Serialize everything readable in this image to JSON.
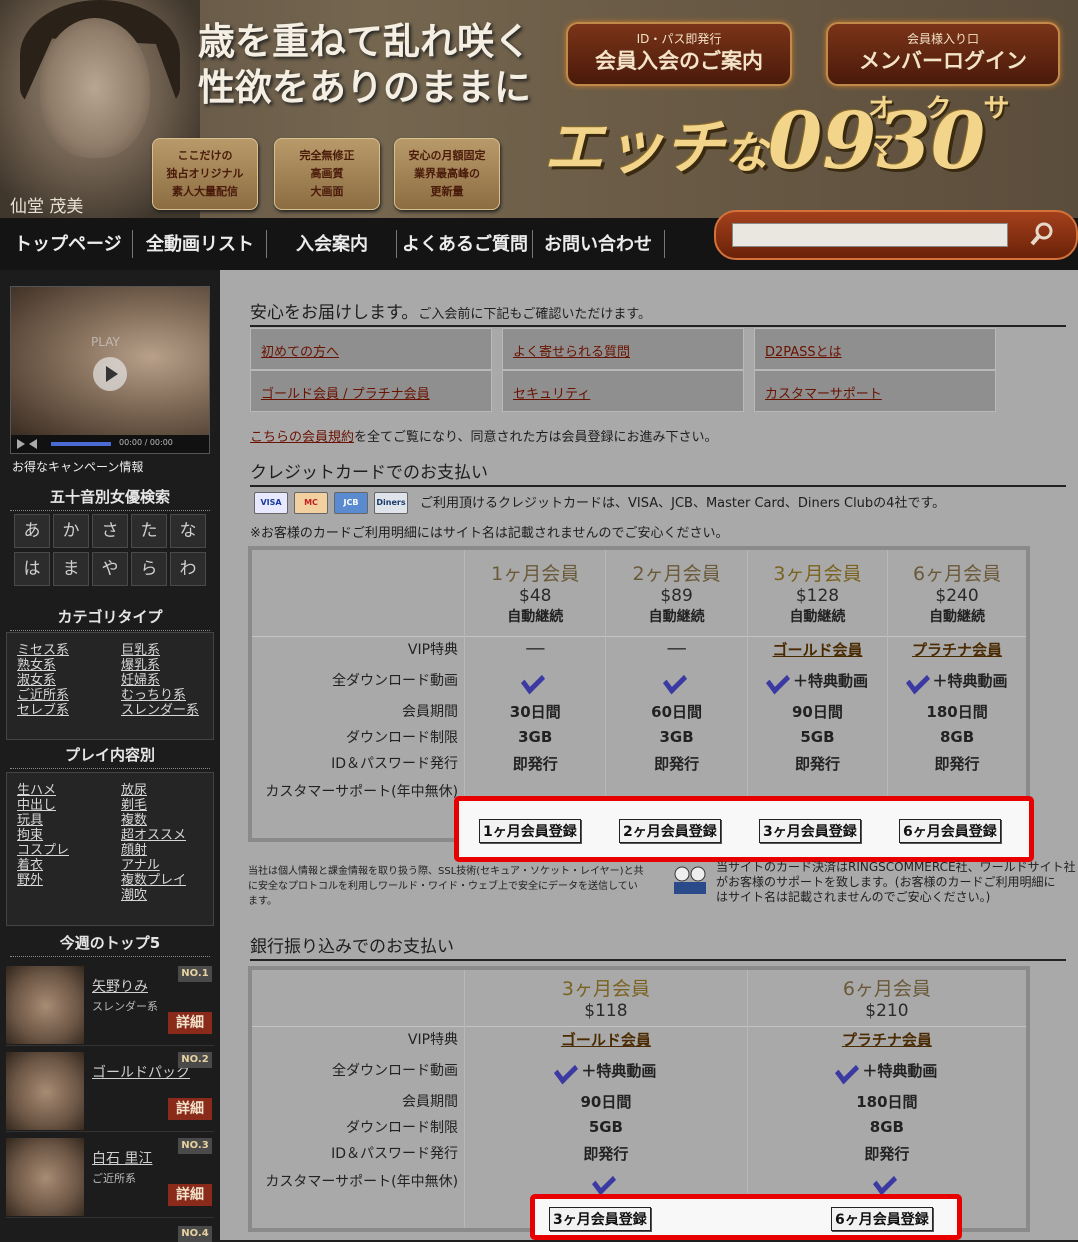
{
  "header": {
    "actress": "仙堂 茂美",
    "headline1": "歳を重ねて乱れ咲く",
    "headline2": "性欲をありのままに",
    "badges": [
      {
        "l1": "ここだけの",
        "l2": "独占オリジナル",
        "l3": "素人大量配信"
      },
      {
        "l1": "完全無修正",
        "l2": "高画質",
        "l3": "大画面"
      },
      {
        "l1": "安心の月額固定",
        "l2": "業界最高峰の",
        "l3": "更新量"
      }
    ],
    "join_small": "ID・パス即発行",
    "join_big": "会員入会のご案内",
    "login_small": "会員様入り口",
    "login_big": "メンバーログイン",
    "logo_main": "エッチ",
    "logo_na": "な",
    "logo_num": "0930",
    "logo_kana": "オクサマ"
  },
  "nav": [
    "トップページ",
    "全動画リスト",
    "入会案内",
    "よくあるご質問",
    "お問い合わせ"
  ],
  "sidebar": {
    "play": "PLAY",
    "time": "00:00 / 00:00",
    "promo_label": "お得なキャンペーン情報",
    "kana_title": "五十音別女優検索",
    "kana": [
      "あ",
      "か",
      "さ",
      "た",
      "な",
      "は",
      "ま",
      "や",
      "ら",
      "わ"
    ],
    "cat_title": "カテゴリタイプ",
    "cat_left": [
      "ミセス系",
      "熟女系",
      "淑女系",
      "ご近所系",
      "セレブ系"
    ],
    "cat_right": [
      "巨乳系",
      "爆乳系",
      "妊婦系",
      "むっちり系",
      "スレンダー系"
    ],
    "play_title": "プレイ内容別",
    "play_left": [
      "生ハメ",
      "中出し",
      "玩具",
      "拘束",
      "コスプレ",
      "着衣",
      "野外"
    ],
    "play_right": [
      "放尿",
      "剃毛",
      "複数",
      "超オススメ",
      "顔射",
      "アナル",
      "複数プレイ",
      "潮吹"
    ],
    "top_title": "今週のトップ5",
    "top5": [
      {
        "name": "矢野りみ",
        "cat": "スレンダー系",
        "no": "NO.1",
        "detail": "詳細"
      },
      {
        "name": "ゴールドパック",
        "cat": "",
        "no": "NO.2",
        "detail": "詳細"
      },
      {
        "name": "白石 里江",
        "cat": "ご近所系",
        "no": "NO.3",
        "detail": "詳細"
      }
    ],
    "no4": "NO.4"
  },
  "main": {
    "intro_title": "安心をお届けします。",
    "intro_sub": "ご入会前に下記もご確認いただけます。",
    "links": [
      "初めての方へ",
      "よく寄せられる質問",
      "D2PASSとは",
      "ゴールド会員 / プラチナ会員",
      "セキュリティ",
      "カスタマーサポート"
    ],
    "terms_link": "こちらの会員規約",
    "terms_rest": "を全てご覧になり、同意された方は会員登録にお進み下さい。",
    "cc_title": "クレジットカードでのお支払い",
    "cc_icons": [
      "VISA",
      "MC",
      "JCB",
      "Diners"
    ],
    "cc_note1": "ご利用頂けるクレジットカードは、VISA、JCB、Master Card、Diners Clubの4社です。",
    "cc_note2": "※お客様のカードご利用明細にはサイト名は記載されませんのでご安心ください。",
    "row_labels": [
      "VIP特典",
      "全ダウンロード動画",
      "会員期間",
      "ダウンロード制限",
      "ID＆パスワード発行",
      "カスタマーサポート(年中無休)"
    ],
    "cc_plans": [
      {
        "name": "1ヶ月会員",
        "price": "$48",
        "renew": "自動継続",
        "vip": "──",
        "bonus": "",
        "period": "30日間",
        "limit": "3GB",
        "issue": "即発行",
        "button": "1ヶ月会員登録"
      },
      {
        "name": "2ヶ月会員",
        "price": "$89",
        "renew": "自動継続",
        "vip": "──",
        "bonus": "",
        "period": "60日間",
        "limit": "3GB",
        "issue": "即発行",
        "button": "2ヶ月会員登録"
      },
      {
        "name": "3ヶ月会員",
        "price": "$128",
        "renew": "自動継続",
        "vip": "ゴールド会員",
        "bonus": "＋特典動画",
        "period": "90日間",
        "limit": "5GB",
        "issue": "即発行",
        "button": "3ヶ月会員登録"
      },
      {
        "name": "6ヶ月会員",
        "price": "$240",
        "renew": "自動継続",
        "vip": "プラチナ会員",
        "bonus": "＋特典動画",
        "period": "180日間",
        "limit": "8GB",
        "issue": "即発行",
        "button": "6ヶ月会員登録"
      }
    ],
    "ssl_note": "当社は個人情報と課金情報を取り扱う際、SSL技術(セキュア・ソケット・レイヤー)と共に安全なプロトコルを利用しワールド・ワイド・ウェブ上で安全にデータを送信しています。",
    "support_note1": "当サイトのカード決済はRINGSCOMMERCE社、ワールドサイト社",
    "support_note2": "がお客様のサポートを致します。(お客様のカードご利用明細に",
    "support_note3": "はサイト名は記載されませんのでご安心ください。)",
    "bank_title": "銀行振り込みでのお支払い",
    "bank_plans": [
      {
        "name": "3ヶ月会員",
        "price": "$118",
        "vip": "ゴールド会員",
        "bonus": "＋特典動画",
        "period": "90日間",
        "limit": "5GB",
        "issue": "即発行",
        "button": "3ヶ月会員登録"
      },
      {
        "name": "6ヶ月会員",
        "price": "$210",
        "vip": "プラチナ会員",
        "bonus": "＋特典動画",
        "period": "180日間",
        "limit": "8GB",
        "issue": "即発行",
        "button": "6ヶ月会員登録"
      }
    ]
  }
}
